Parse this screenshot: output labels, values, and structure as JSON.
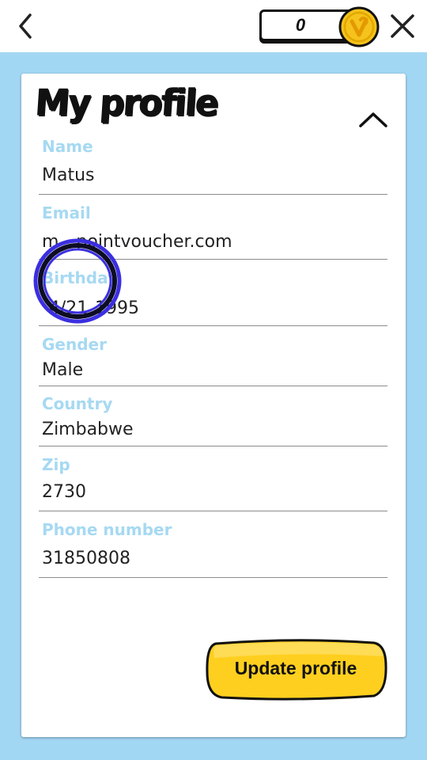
{
  "header": {
    "coin_count": "0",
    "back_icon": "chevron-left-icon",
    "close_icon": "close-icon",
    "coin_icon": "gold-coin-icon"
  },
  "profile": {
    "title": "My profile",
    "collapse_icon": "chevron-up-icon",
    "fields": [
      {
        "label": "Name",
        "value": "Matus"
      },
      {
        "label": "Email",
        "value": "m     pointvoucher.com"
      },
      {
        "label": "Birthday",
        "value": "  4/21  1995"
      },
      {
        "label": "Gender",
        "value": "Male"
      },
      {
        "label": "Country",
        "value": "Zimbabwe"
      },
      {
        "label": "Zip",
        "value": "2730"
      },
      {
        "label": "Phone number",
        "value": "31850808"
      }
    ],
    "update_button": "Update profile"
  },
  "colors": {
    "background": "#a2d7f4",
    "label": "#a6d9f2",
    "button": "#ffcf1f",
    "coin": "#f6c21c",
    "touch_marker": "#3b2fe0"
  }
}
